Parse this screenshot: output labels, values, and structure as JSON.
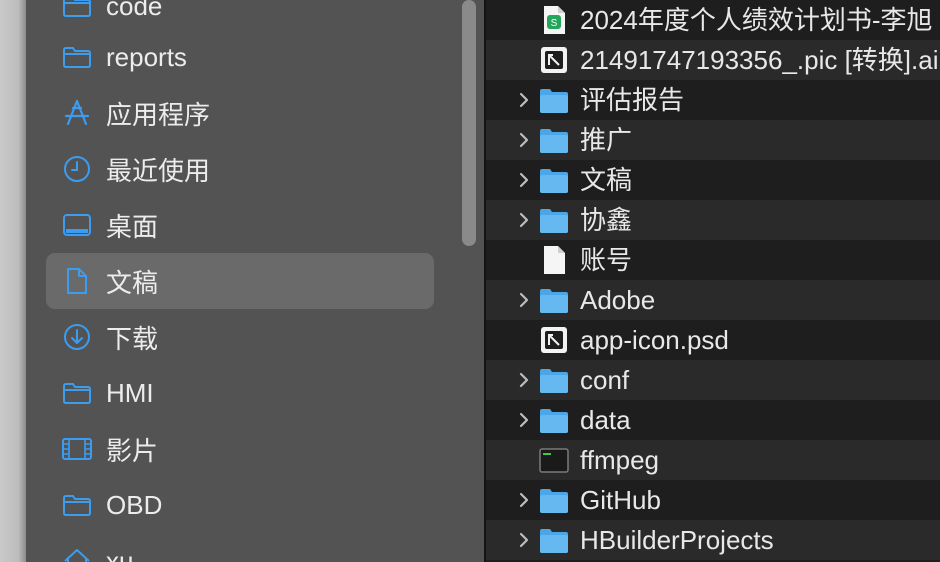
{
  "sidebar": {
    "items": [
      {
        "label": "code",
        "icon": "folder-icon"
      },
      {
        "label": "reports",
        "icon": "folder-icon"
      },
      {
        "label": "应用程序",
        "icon": "applications-icon"
      },
      {
        "label": "最近使用",
        "icon": "clock-icon"
      },
      {
        "label": "桌面",
        "icon": "desktop-icon"
      },
      {
        "label": "文稿",
        "icon": "document-icon",
        "selected": true
      },
      {
        "label": "下载",
        "icon": "download-icon"
      },
      {
        "label": "HMI",
        "icon": "folder-icon"
      },
      {
        "label": "影片",
        "icon": "film-icon"
      },
      {
        "label": "OBD",
        "icon": "folder-icon"
      },
      {
        "label": "xu",
        "icon": "home-icon"
      }
    ],
    "accent": "#3b9cf0"
  },
  "files": {
    "items": [
      {
        "name": "2024年度个人绩效计划书-李旭",
        "type": "spreadsheet"
      },
      {
        "name": "21491747193356_.pic [转换].ai",
        "type": "image-file"
      },
      {
        "name": "评估报告",
        "type": "folder"
      },
      {
        "name": "推广",
        "type": "folder"
      },
      {
        "name": "文稿",
        "type": "folder"
      },
      {
        "name": "协鑫",
        "type": "folder"
      },
      {
        "name": "账号",
        "type": "blank-file"
      },
      {
        "name": "Adobe",
        "type": "folder"
      },
      {
        "name": "app-icon.psd",
        "type": "image-file"
      },
      {
        "name": "conf",
        "type": "folder"
      },
      {
        "name": "data",
        "type": "folder"
      },
      {
        "name": "ffmpeg",
        "type": "executable"
      },
      {
        "name": "GitHub",
        "type": "folder"
      },
      {
        "name": "HBuilderProjects",
        "type": "folder"
      }
    ]
  }
}
